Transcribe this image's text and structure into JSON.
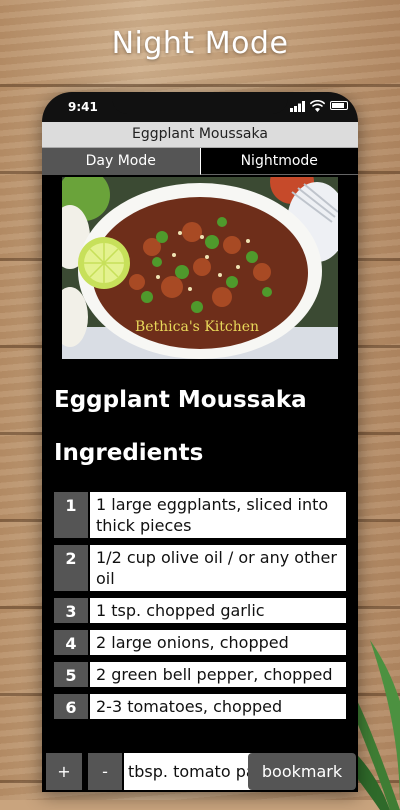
{
  "banner": {
    "title": "Night Mode"
  },
  "status": {
    "time": "9:41"
  },
  "app": {
    "title": "Eggplant Moussaka",
    "modes": {
      "day": "Day Mode",
      "night": "Nightmode"
    },
    "photo": {
      "watermark": "Bethica's Kitchen"
    },
    "recipe_title": "Eggplant Moussaka",
    "section_title": "Ingredients",
    "ingredients": [
      {
        "num": "1",
        "text": "1 large eggplants, sliced into thick pieces"
      },
      {
        "num": "2",
        "text": "1/2 cup olive oil / or any other oil"
      },
      {
        "num": "3",
        "text": "1 tsp. chopped garlic"
      },
      {
        "num": "4",
        "text": "2 large onions, chopped"
      },
      {
        "num": "5",
        "text": "2 green bell pepper, chopped"
      },
      {
        "num": "6",
        "text": "2-3 tomatoes, chopped"
      }
    ],
    "bottom": {
      "plus": "+",
      "minus": "-",
      "partial_text": "tbsp. tomato pa",
      "bookmark": "bookmark"
    }
  },
  "colors": {
    "screen_bg": "#000000",
    "button_bg": "#555555",
    "titlebar_bg": "#dcdcdc"
  }
}
